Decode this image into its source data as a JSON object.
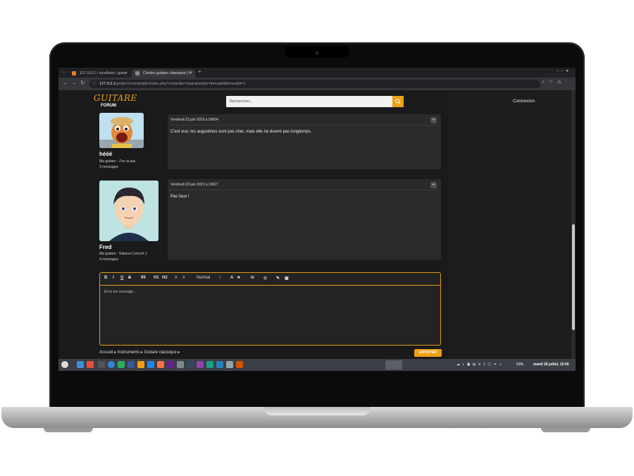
{
  "browser": {
    "tabs": [
      {
        "title": "127.0.0.1 / localhost / guita"
      },
      {
        "title": "Cordes guitare classique | F"
      }
    ],
    "url_host": "127.0.0.1",
    "url_path": "/projet-forum/public/index.php?controller=topic&action=threadId&threadId=1"
  },
  "header": {
    "logo": "GUITARE",
    "logo_sub": "FORUM",
    "search_placeholder": "Rechercher...",
    "login": "Connexion"
  },
  "posts": [
    {
      "author": "hééé",
      "guitar": "Ma guitare : J'en ai pas",
      "count": "3 messages",
      "date": "Vendredi 23 juin 2023 à 09h54",
      "body": "C'est vrai, les augustines sont pas cher, mais elle ne durent pas longtemps."
    },
    {
      "author": "Fred",
      "guitar": "Ma guitare : Sakurai Concert J",
      "count": "4 messages",
      "date": "Vendredi 23 juin 2023 à 10h27",
      "body": "Pas faux !"
    }
  ],
  "editor": {
    "toolbar": [
      "B",
      "I",
      "U",
      "S",
      "99",
      "H1",
      "H2",
      "≡",
      "≡",
      "Normal",
      "↕",
      "A",
      "■",
      "Ix",
      "⊙",
      "✎",
      "▣"
    ],
    "placeholder": "Écris ton message..."
  },
  "breadcrumb": "Accueil ▸ Instruments ▸ Guitare classique ▸",
  "send_button": "ENVOYER",
  "taskbar": {
    "battery": "53%",
    "datetime": "mardi 26 juillet, 15:00"
  },
  "colors": {
    "accent": "#f0a014",
    "page_bg": "#1a1a1a",
    "card_bg": "#2a2a2a"
  }
}
